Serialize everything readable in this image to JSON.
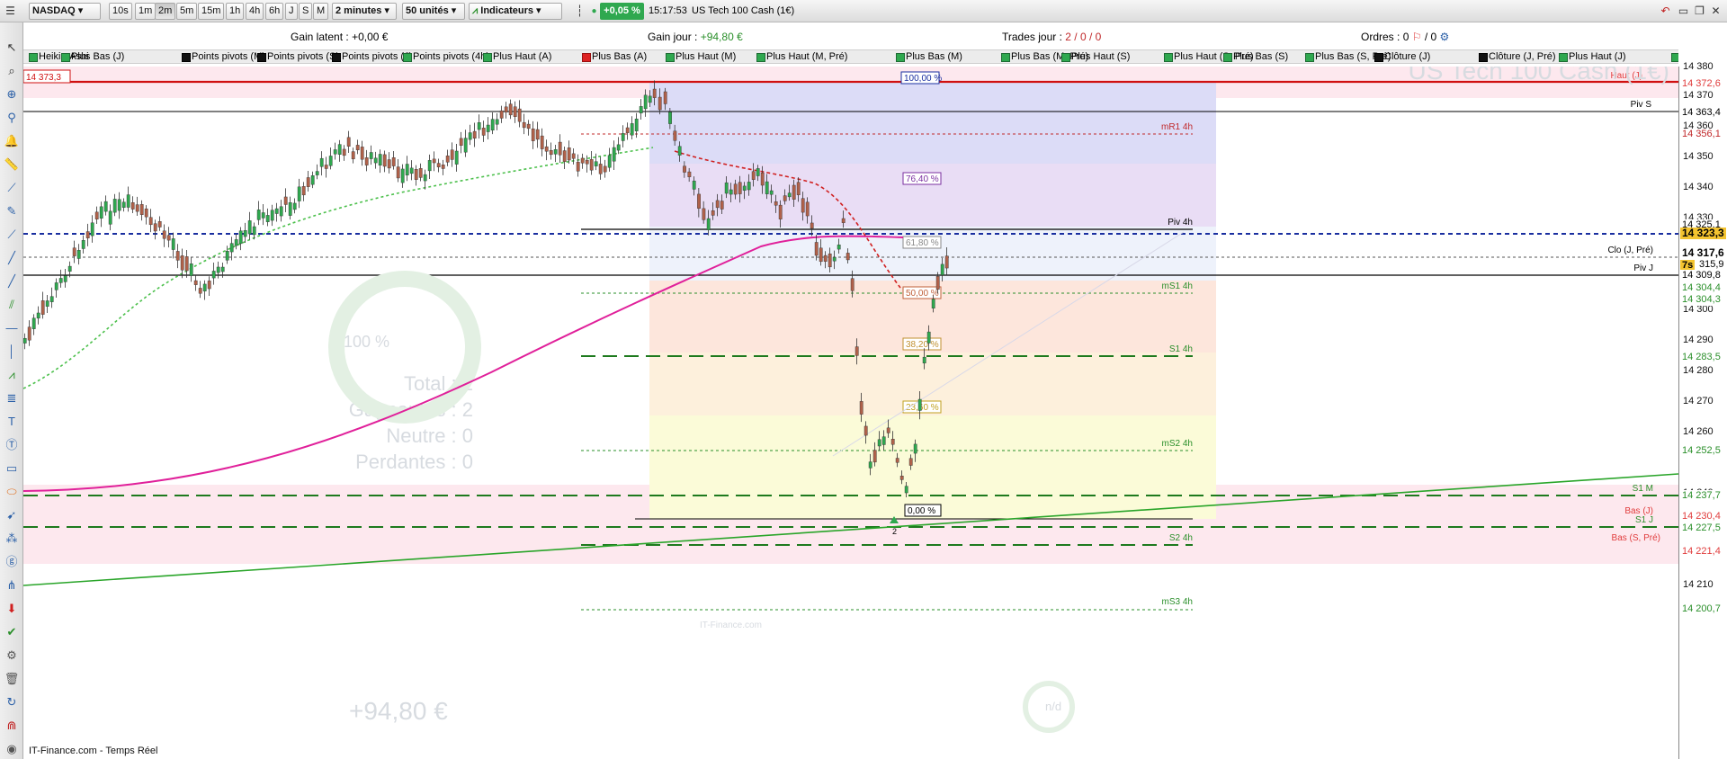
{
  "toolbar": {
    "instrument": "NASDAQ",
    "timeframes": [
      "10s",
      "1m",
      "2m",
      "5m",
      "15m",
      "1h",
      "4h",
      "6h",
      "J",
      "S",
      "M"
    ],
    "selected_timeframe": "2m",
    "interval": "2 minutes",
    "units": "50 unités",
    "indicators_label": "Indicateurs",
    "change_pct": "+0,05 %",
    "clock": "15:17:53",
    "instrument_full": "US Tech 100 Cash (1€)"
  },
  "infobar": {
    "gain_latent_label": "Gain latent :",
    "gain_latent_value": "+0,00 €",
    "gain_jour_label": "Gain jour :",
    "gain_jour_value": "+94,80 €",
    "trades_label": "Trades jour :",
    "trades_value": "2 / 0 / 0",
    "ordres_label": "Ordres :",
    "ordres_value": "0",
    "ordres_value2": "/ 0"
  },
  "indicator_tabs": [
    {
      "label": "Heikin-Ashi",
      "mark": "green"
    },
    {
      "label": "Plus Bas (J)",
      "mark": "green"
    },
    {
      "label": "Points pivots (M)",
      "mark": "black"
    },
    {
      "label": "Points pivots (S)",
      "mark": "black"
    },
    {
      "label": "Points pivots (J)",
      "mark": "black"
    },
    {
      "label": "Points pivots (4h)",
      "mark": "green"
    },
    {
      "label": "Plus Haut (A)",
      "mark": "green"
    },
    {
      "label": "Plus Bas (A)",
      "mark": "red"
    },
    {
      "label": "Plus Haut (M)",
      "mark": "green"
    },
    {
      "label": "Plus Haut (M, Pré)",
      "mark": "green"
    },
    {
      "label": "Plus Bas (M)",
      "mark": "green"
    },
    {
      "label": "Plus Bas (M, Pré)",
      "mark": "green"
    },
    {
      "label": "Plus Haut (S)",
      "mark": "green"
    },
    {
      "label": "Plus Haut (S, Pré)",
      "mark": "green"
    },
    {
      "label": "Plus Bas (S)",
      "mark": "green"
    },
    {
      "label": "Plus Bas (S, Pré)",
      "mark": "green"
    },
    {
      "label": "Clôture (J)",
      "mark": "black"
    },
    {
      "label": "Clôture (J, Pré)",
      "mark": "black"
    },
    {
      "label": "Plus Haut (J)",
      "mark": "green"
    },
    {
      "label": "Plus Haut (J",
      "mark": "green"
    }
  ],
  "chart": {
    "watermark": "US Tech 100 Cash (1€)",
    "price_top_left": "14 373,3",
    "ghost_total": "Total : 2",
    "ghost_gagnantes": "Gagnantes : 2",
    "ghost_neutre": "Neutre : 0",
    "ghost_perdantes": "Perdantes : 0",
    "ghost_gain": "+94,80 €",
    "ghost_donut": "100 %",
    "ghost_nd": "n/d",
    "ghost_site": "IT-Finance.com",
    "marker_count": "2",
    "colors": {
      "up": "#2fa84f",
      "down": "#b0614a",
      "ma_pink": "#e0209a",
      "ma_green": "#4cc04c",
      "pivot_blue": "#1a2fa0"
    },
    "levels": [
      {
        "label": "Haut (J)",
        "color": "#e03c3c"
      },
      {
        "label": "Piv S",
        "color": "#000"
      },
      {
        "label": "mR1 4h",
        "color": "#c0282a"
      },
      {
        "label": "Piv 4h",
        "color": "#000"
      },
      {
        "label": "Clo (J, Pré)",
        "color": "#000"
      },
      {
        "label": "Piv J",
        "color": "#000"
      },
      {
        "label": "mS1 4h",
        "color": "#2a8f2a"
      },
      {
        "label": "S1 4h",
        "color": "#2a8f2a"
      },
      {
        "label": "mS2 4h",
        "color": "#2a8f2a"
      },
      {
        "label": "S1 M",
        "color": "#2a8f2a"
      },
      {
        "label": "Bas (J)",
        "color": "#e03c3c"
      },
      {
        "label": "S1 J",
        "color": "#2a8f2a"
      },
      {
        "label": "Bas (S, Pré)",
        "color": "#e03c3c"
      },
      {
        "label": "S2 4h",
        "color": "#2a8f2a"
      },
      {
        "label": "mS3 4h",
        "color": "#2a8f2a"
      }
    ],
    "fibonacci": [
      "100,00 %",
      "76,40 %",
      "61,80 %",
      "50,00 %",
      "38,20 %",
      "23,60 %",
      "0,00 %"
    ]
  },
  "axis": {
    "ticks": [
      "14 380",
      "14 370",
      "14 360",
      "14 350",
      "14 340",
      "14 330",
      "14 300",
      "14 290",
      "14 280",
      "14 270",
      "14 260",
      "14 240",
      "14 210"
    ],
    "tags": [
      {
        "text": "14 372,6",
        "color": "#e03c3c"
      },
      {
        "text": "14 363,4",
        "color": "#000"
      },
      {
        "text": "14 356,1",
        "color": "#c0282a"
      },
      {
        "text": "14 325,1",
        "color": "#000"
      },
      {
        "text": "14 323,3",
        "color": "#000"
      },
      {
        "text": "14 317,6",
        "color": "#000"
      },
      {
        "text": "7s",
        "color": "#000"
      },
      {
        "text": "315,9",
        "color": "#000"
      },
      {
        "text": "14 309,8",
        "color": "#000"
      },
      {
        "text": "14 304,4",
        "color": "#2a8f2a"
      },
      {
        "text": "14 304,3",
        "color": "#2a8f2a"
      },
      {
        "text": "14 283,5",
        "color": "#2a8f2a"
      },
      {
        "text": "14 252,5",
        "color": "#2a8f2a"
      },
      {
        "text": "14 237,7",
        "color": "#2a8f2a"
      },
      {
        "text": "14 230,4",
        "color": "#e03c3c"
      },
      {
        "text": "14 227,5",
        "color": "#2a8f2a"
      },
      {
        "text": "14 221,4",
        "color": "#e03c3c"
      },
      {
        "text": "14 200,7",
        "color": "#2a8f2a"
      }
    ]
  },
  "footer": "IT-Finance.com - Temps Réel"
}
